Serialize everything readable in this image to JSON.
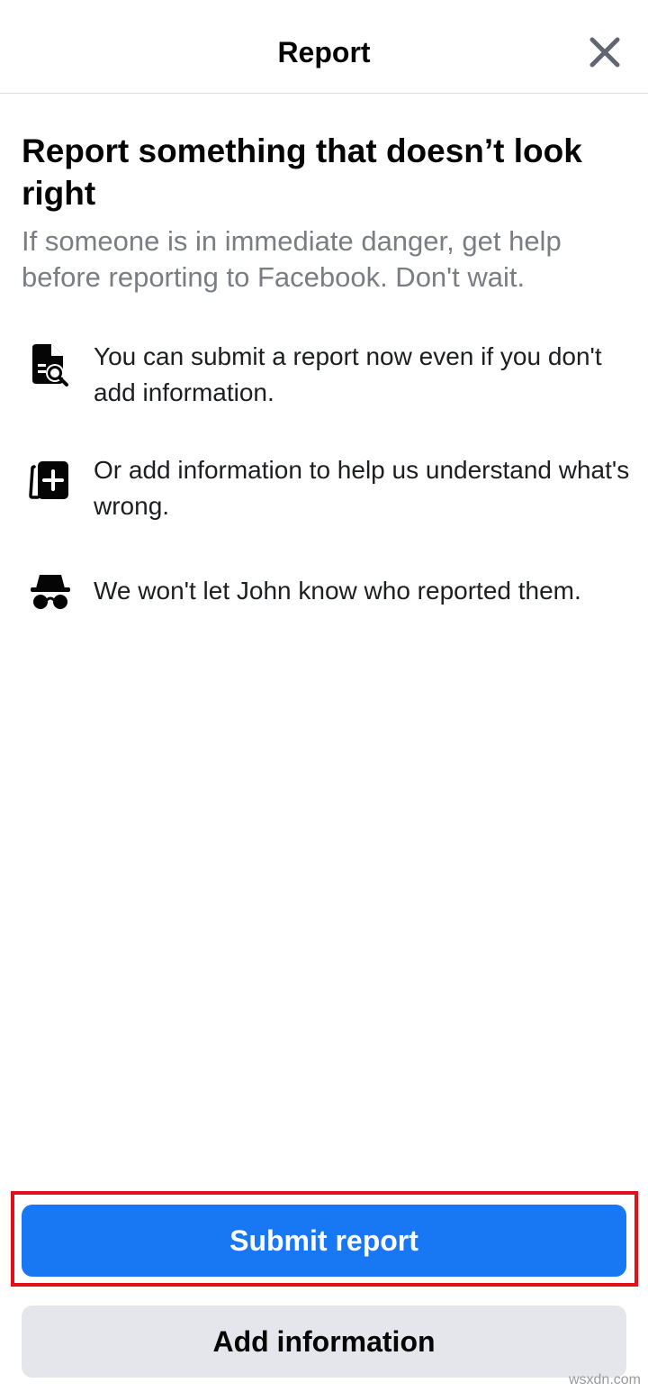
{
  "header": {
    "title": "Report",
    "close_icon": "close-icon"
  },
  "main": {
    "title": "Report something that doesn’t look right",
    "subtitle": "If someone is in immediate danger, get help before reporting to Facebook. Don't wait."
  },
  "info_items": [
    {
      "icon": "document-search-icon",
      "text": "You can submit a report now even if you don't add information."
    },
    {
      "icon": "add-card-icon",
      "text": "Or add information to help us understand what's wrong."
    },
    {
      "icon": "incognito-icon",
      "text": "We won't let John know who reported them."
    }
  ],
  "actions": {
    "submit_label": "Submit report",
    "add_info_label": "Add information"
  },
  "watermark": "wsxdn.com",
  "colors": {
    "primary": "#1877f2",
    "secondary_button": "#e4e6eb",
    "highlight": "#e2101b",
    "subtitle_text": "#7a7d82"
  }
}
